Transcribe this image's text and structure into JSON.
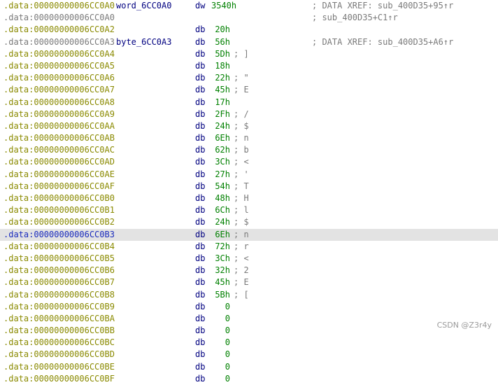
{
  "rows": [
    {
      "addr": ".data:00000000006CC0A0",
      "label": "word_6CC0A0",
      "mnemonic": "dw",
      "operand": "3540h",
      "comment": "",
      "xref": "; DATA XREF: sub_400D35+95↑r",
      "addr_style": "normal"
    },
    {
      "addr": ".data:00000000006CC0A0",
      "label": "",
      "mnemonic": "",
      "operand": "",
      "comment": "",
      "xref": "; sub_400D35+C1↑r",
      "addr_style": "cont"
    },
    {
      "addr": ".data:00000000006CC0A2",
      "label": "",
      "mnemonic": "db",
      "operand": "20h",
      "comment": "",
      "xref": "",
      "addr_style": "normal"
    },
    {
      "addr": ".data:00000000006CC0A3",
      "label": "byte_6CC0A3",
      "mnemonic": "db",
      "operand": "56h",
      "comment": "",
      "xref": "; DATA XREF: sub_400D35+A6↑r",
      "addr_style": "cont"
    },
    {
      "addr": ".data:00000000006CC0A4",
      "label": "",
      "mnemonic": "db",
      "operand": "5Dh",
      "comment": "; ]",
      "xref": "",
      "addr_style": "normal"
    },
    {
      "addr": ".data:00000000006CC0A5",
      "label": "",
      "mnemonic": "db",
      "operand": "18h",
      "comment": "",
      "xref": "",
      "addr_style": "normal"
    },
    {
      "addr": ".data:00000000006CC0A6",
      "label": "",
      "mnemonic": "db",
      "operand": "22h",
      "comment": "; \"",
      "xref": "",
      "addr_style": "normal"
    },
    {
      "addr": ".data:00000000006CC0A7",
      "label": "",
      "mnemonic": "db",
      "operand": "45h",
      "comment": "; E",
      "xref": "",
      "addr_style": "normal"
    },
    {
      "addr": ".data:00000000006CC0A8",
      "label": "",
      "mnemonic": "db",
      "operand": "17h",
      "comment": "",
      "xref": "",
      "addr_style": "normal"
    },
    {
      "addr": ".data:00000000006CC0A9",
      "label": "",
      "mnemonic": "db",
      "operand": "2Fh",
      "comment": "; /",
      "xref": "",
      "addr_style": "normal"
    },
    {
      "addr": ".data:00000000006CC0AA",
      "label": "",
      "mnemonic": "db",
      "operand": "24h",
      "comment": "; $",
      "xref": "",
      "addr_style": "normal"
    },
    {
      "addr": ".data:00000000006CC0AB",
      "label": "",
      "mnemonic": "db",
      "operand": "6Eh",
      "comment": "; n",
      "xref": "",
      "addr_style": "normal"
    },
    {
      "addr": ".data:00000000006CC0AC",
      "label": "",
      "mnemonic": "db",
      "operand": "62h",
      "comment": "; b",
      "xref": "",
      "addr_style": "normal"
    },
    {
      "addr": ".data:00000000006CC0AD",
      "label": "",
      "mnemonic": "db",
      "operand": "3Ch",
      "comment": "; <",
      "xref": "",
      "addr_style": "normal"
    },
    {
      "addr": ".data:00000000006CC0AE",
      "label": "",
      "mnemonic": "db",
      "operand": "27h",
      "comment": "; '",
      "xref": "",
      "addr_style": "normal"
    },
    {
      "addr": ".data:00000000006CC0AF",
      "label": "",
      "mnemonic": "db",
      "operand": "54h",
      "comment": "; T",
      "xref": "",
      "addr_style": "normal"
    },
    {
      "addr": ".data:00000000006CC0B0",
      "label": "",
      "mnemonic": "db",
      "operand": "48h",
      "comment": "; H",
      "xref": "",
      "addr_style": "normal"
    },
    {
      "addr": ".data:00000000006CC0B1",
      "label": "",
      "mnemonic": "db",
      "operand": "6Ch",
      "comment": "; l",
      "xref": "",
      "addr_style": "normal"
    },
    {
      "addr": ".data:00000000006CC0B2",
      "label": "",
      "mnemonic": "db",
      "operand": "24h",
      "comment": "; $",
      "xref": "",
      "addr_style": "normal"
    },
    {
      "addr": ".data:00000000006CC0B3",
      "label": "",
      "mnemonic": "db",
      "operand": "6Eh",
      "comment": "; n",
      "xref": "",
      "addr_style": "normal",
      "selected": true
    },
    {
      "addr": ".data:00000000006CC0B4",
      "label": "",
      "mnemonic": "db",
      "operand": "72h",
      "comment": "; r",
      "xref": "",
      "addr_style": "normal"
    },
    {
      "addr": ".data:00000000006CC0B5",
      "label": "",
      "mnemonic": "db",
      "operand": "3Ch",
      "comment": "; <",
      "xref": "",
      "addr_style": "normal"
    },
    {
      "addr": ".data:00000000006CC0B6",
      "label": "",
      "mnemonic": "db",
      "operand": "32h",
      "comment": "; 2",
      "xref": "",
      "addr_style": "normal"
    },
    {
      "addr": ".data:00000000006CC0B7",
      "label": "",
      "mnemonic": "db",
      "operand": "45h",
      "comment": "; E",
      "xref": "",
      "addr_style": "normal"
    },
    {
      "addr": ".data:00000000006CC0B8",
      "label": "",
      "mnemonic": "db",
      "operand": "5Bh",
      "comment": "; [",
      "xref": "",
      "addr_style": "normal"
    },
    {
      "addr": ".data:00000000006CC0B9",
      "label": "",
      "mnemonic": "db",
      "operand": "0",
      "comment": "",
      "xref": "",
      "addr_style": "normal"
    },
    {
      "addr": ".data:00000000006CC0BA",
      "label": "",
      "mnemonic": "db",
      "operand": "0",
      "comment": "",
      "xref": "",
      "addr_style": "normal"
    },
    {
      "addr": ".data:00000000006CC0BB",
      "label": "",
      "mnemonic": "db",
      "operand": "0",
      "comment": "",
      "xref": "",
      "addr_style": "normal"
    },
    {
      "addr": ".data:00000000006CC0BC",
      "label": "",
      "mnemonic": "db",
      "operand": "0",
      "comment": "",
      "xref": "",
      "addr_style": "normal"
    },
    {
      "addr": ".data:00000000006CC0BD",
      "label": "",
      "mnemonic": "db",
      "operand": "0",
      "comment": "",
      "xref": "",
      "addr_style": "normal"
    },
    {
      "addr": ".data:00000000006CC0BE",
      "label": "",
      "mnemonic": "db",
      "operand": "0",
      "comment": "",
      "xref": "",
      "addr_style": "normal"
    },
    {
      "addr": ".data:00000000006CC0BF",
      "label": "",
      "mnemonic": "db",
      "operand": "0",
      "comment": "",
      "xref": "",
      "addr_style": "normal"
    }
  ],
  "watermark": "CSDN @Z3r4y"
}
